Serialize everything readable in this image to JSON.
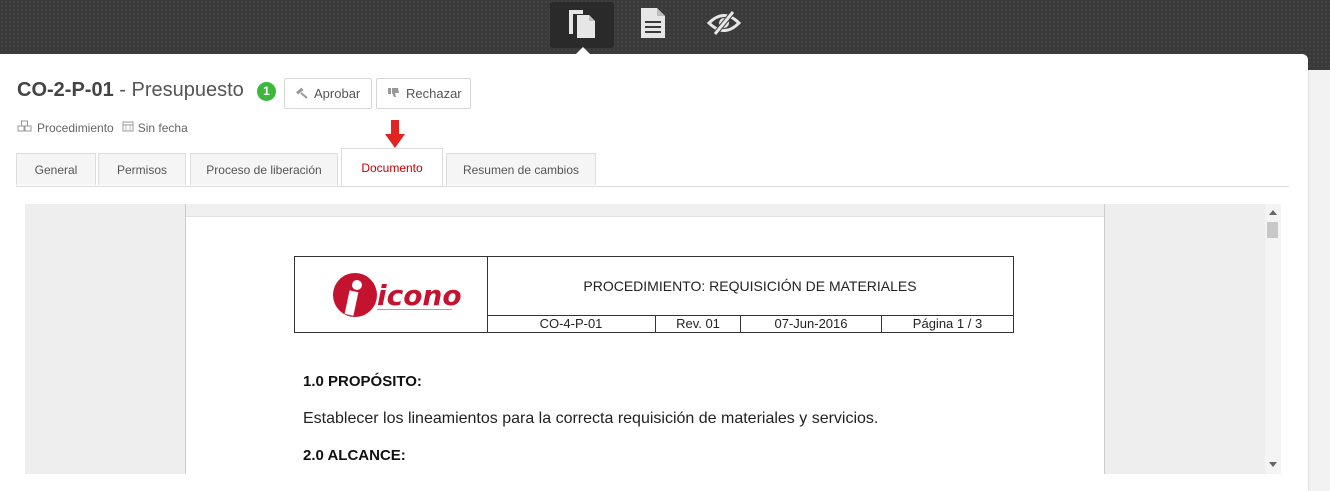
{
  "topbar": {
    "buttons": [
      {
        "icon": "documents-icon",
        "active": true
      },
      {
        "icon": "document-text-icon",
        "active": false
      },
      {
        "icon": "eye-slash-icon",
        "active": false
      }
    ]
  },
  "header": {
    "code": "CO-2-P-01",
    "separator": " - ",
    "name": "Presupuesto",
    "badge_count": "1",
    "approve_label": "Aprobar",
    "reject_label": "Rechazar"
  },
  "meta": {
    "type_label": "Procedimiento",
    "date_label": "Sin fecha"
  },
  "tabs": [
    {
      "label": "General"
    },
    {
      "label": "Permisos"
    },
    {
      "label": "Proceso de liberación"
    },
    {
      "label": "Documento",
      "active": true
    },
    {
      "label": "Resumen de cambios"
    }
  ],
  "document": {
    "logo_text": "icono",
    "procedure_title": "PROCEDIMIENTO: REQUISICIÓN DE MATERIALES",
    "doc_code": "CO-4-P-01",
    "revision": "Rev. 01",
    "date": "07-Jun-2016",
    "page": "Página 1 / 3",
    "section1_title": "1.0 PROPÓSITO:",
    "section1_text": "Establecer los lineamientos para la correcta requisición de materiales y servicios.",
    "section2_title": "2.0 ALCANCE:"
  },
  "colors": {
    "active_tab": "#cc0000",
    "badge": "#3cb93c",
    "arrow": "#e32222",
    "logo": "#c4122f"
  }
}
